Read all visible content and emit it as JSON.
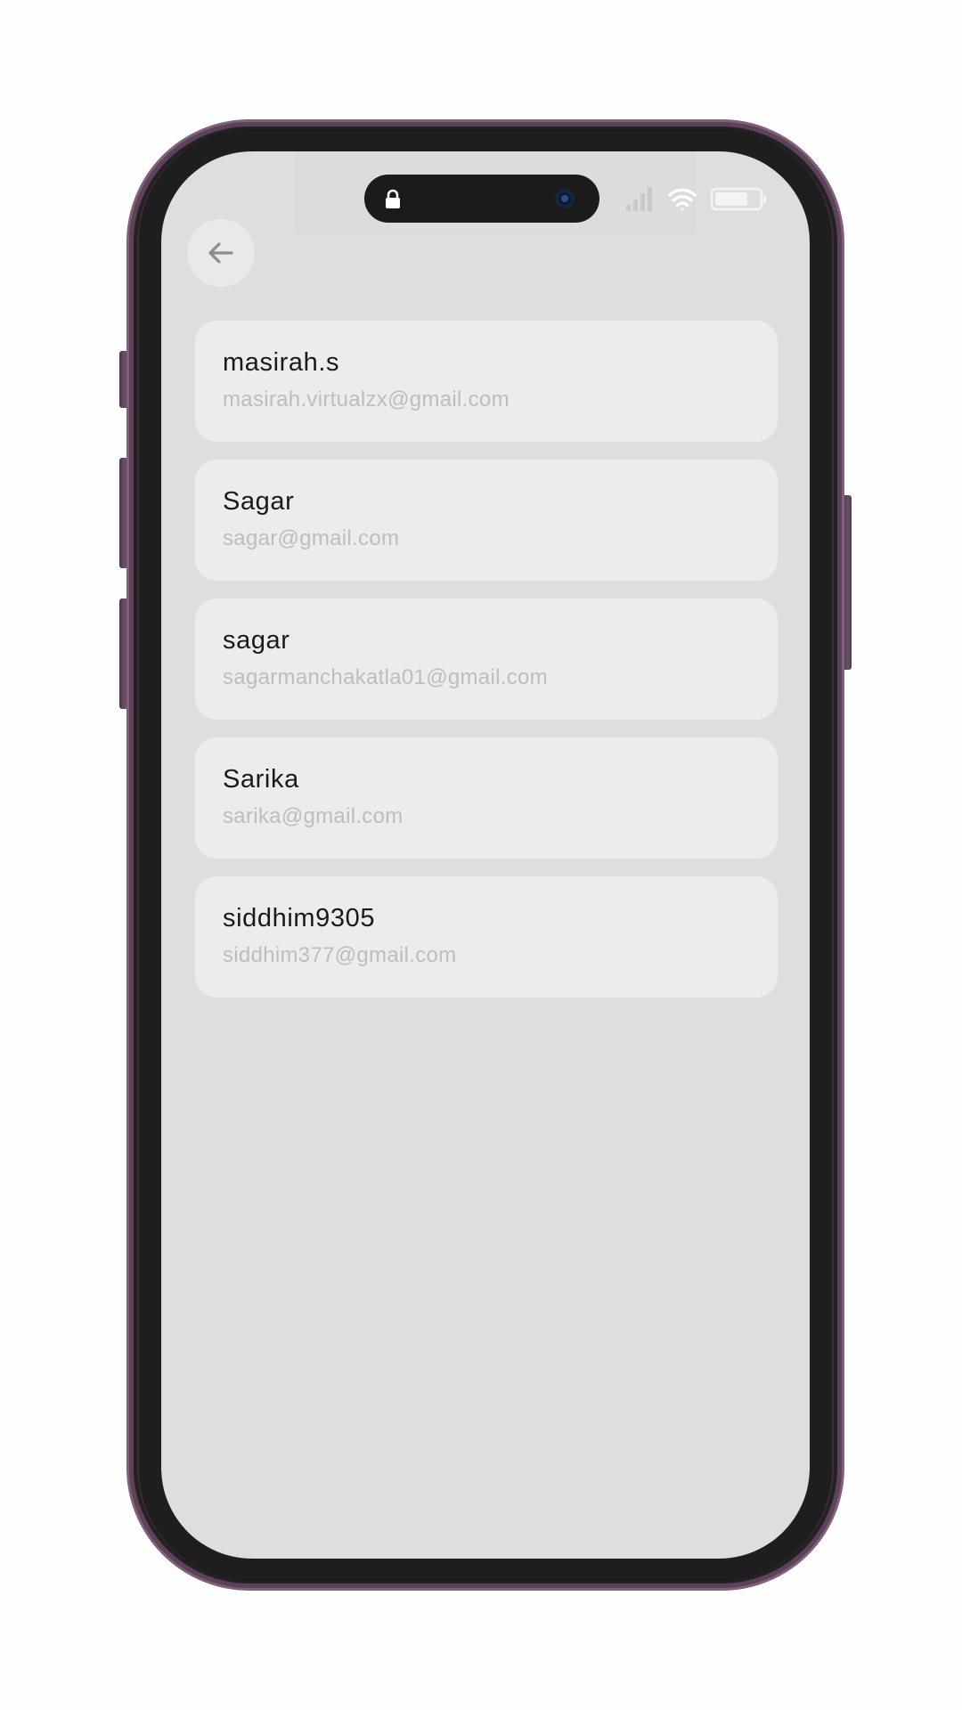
{
  "status_bar": {
    "icons": [
      "lock-icon",
      "camera-icon",
      "signal-icon",
      "wifi-icon",
      "battery-icon"
    ]
  },
  "header": {
    "back_icon": "arrow-left-icon"
  },
  "users": [
    {
      "name": "masirah.s",
      "email": "masirah.virtualzx@gmail.com"
    },
    {
      "name": "Sagar",
      "email": "sagar@gmail.com"
    },
    {
      "name": "sagar",
      "email": "sagarmanchakatla01@gmail.com"
    },
    {
      "name": "Sarika",
      "email": "sarika@gmail.com"
    },
    {
      "name": "siddhim9305",
      "email": "siddhim377@gmail.com"
    }
  ],
  "colors": {
    "screen_background": "#dedede",
    "card_background": "#ececec",
    "name_text": "#1a1a1a",
    "email_text": "#bdbdbd",
    "phone_frame": "#5d4259"
  }
}
